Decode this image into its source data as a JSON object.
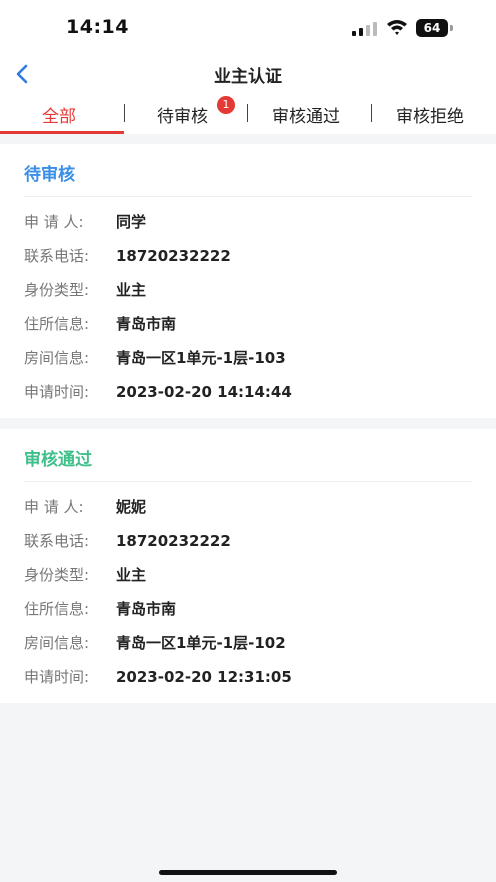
{
  "status_bar": {
    "time": "14:14",
    "battery_level": "64"
  },
  "nav": {
    "title": "业主认证"
  },
  "tabs": [
    {
      "label": "全部",
      "active": true
    },
    {
      "label": "待审核",
      "badge": "1"
    },
    {
      "label": "审核通过"
    },
    {
      "label": "审核拒绝"
    }
  ],
  "records": [
    {
      "status": "待审核",
      "status_color": "#3a8ee6",
      "fields": [
        {
          "label": "申 请 人:",
          "value": "同学"
        },
        {
          "label": "联系电话:",
          "value": "18720232222"
        },
        {
          "label": "身份类型:",
          "value": "业主"
        },
        {
          "label": "住所信息:",
          "value": "青岛市南"
        },
        {
          "label": "房间信息:",
          "value": "青岛一区1单元-1层-103"
        },
        {
          "label": "申请时间:",
          "value": "2023-02-20 14:14:44"
        }
      ]
    },
    {
      "status": "审核通过",
      "status_color": "#3fbf8a",
      "fields": [
        {
          "label": "申 请 人:",
          "value": "妮妮"
        },
        {
          "label": "联系电话:",
          "value": "18720232222"
        },
        {
          "label": "身份类型:",
          "value": "业主"
        },
        {
          "label": "住所信息:",
          "value": "青岛市南"
        },
        {
          "label": "房间信息:",
          "value": "青岛一区1单元-1层-102"
        },
        {
          "label": "申请时间:",
          "value": "2023-02-20 12:31:05"
        }
      ]
    }
  ],
  "colors": {
    "accent": "#e53935",
    "background": "#f4f5f7"
  }
}
